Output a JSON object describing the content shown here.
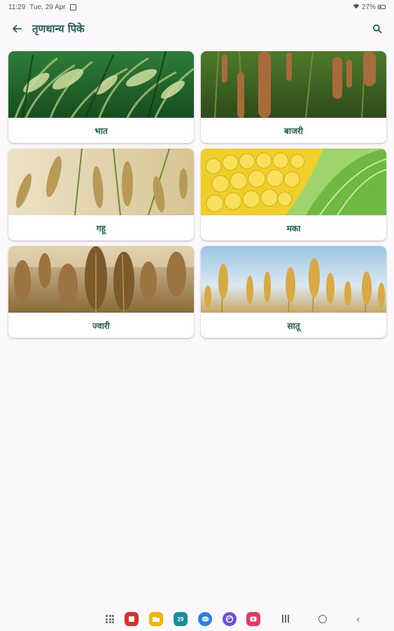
{
  "status_bar": {
    "time": "11:29",
    "date": "Tue, 29 Apr",
    "battery": "27%"
  },
  "app_bar": {
    "title": "तृणधान्य पिके",
    "back_icon": "arrow-left-icon",
    "search_icon": "search-icon"
  },
  "crops": [
    {
      "label": "भात",
      "image": "rice-field"
    },
    {
      "label": "बाजरी",
      "image": "pearl-millet-field"
    },
    {
      "label": "गहू",
      "image": "wheat-field"
    },
    {
      "label": "मका",
      "image": "corn-cob"
    },
    {
      "label": "ज्वारी",
      "image": "sorghum-field"
    },
    {
      "label": "सातू",
      "image": "barley-field"
    }
  ],
  "colors": {
    "accent": "#1f5e55",
    "background": "#fbf8fc"
  },
  "dock": {
    "date_badge": "29"
  }
}
